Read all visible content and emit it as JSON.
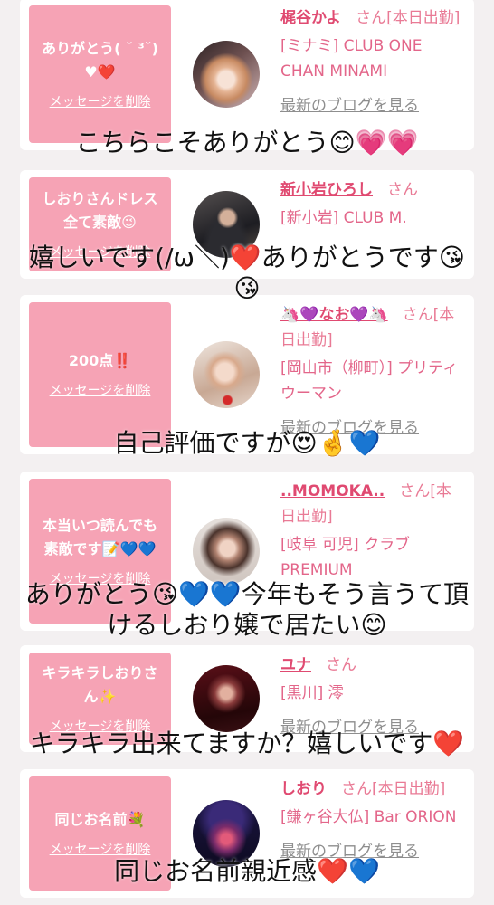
{
  "colors": {
    "background": "#f3f0f1",
    "card": "#ffffff",
    "bubble": "#f6a3b5",
    "name": "#e04a71",
    "suffix": "#e97a95",
    "shop": "#e3668a",
    "blog_link": "#8e8e8e",
    "caption": "#111111"
  },
  "cards": [
    {
      "message": "ありがとう( ˘ ³˘)♥❤️",
      "delete_label": "メッセージを削除",
      "name": "梶谷かよ",
      "suffix": "さん[本日出勤]",
      "shop": "[ミナミ] CLUB ONE CHAN MINAMI",
      "blog_link": "最新のブログを見る"
    },
    {
      "message": "しおりさんドレス全て素敵😉",
      "delete_label": "メッセージを削除",
      "name": "新小岩ひろし",
      "suffix": "さん",
      "shop": "[新小岩] CLUB M."
    },
    {
      "message": "200点‼️",
      "delete_label": "メッセージを削除",
      "name": "🦄💜なお💜🦄",
      "suffix": "さん[本日出勤]",
      "shop": "[岡山市（柳町）] プリティウーマン",
      "blog_link": "最新のブログを見る"
    },
    {
      "message": "本当いつ読んでも素敵です📝💙💙",
      "delete_label": "メッセージを削除",
      "name": "..MOMOKA..",
      "suffix": "さん[本日出勤]",
      "shop": "[岐阜 可児] クラブPREMIUM"
    },
    {
      "message": "キラキラしおりさん✨",
      "delete_label": "メッセージを削除",
      "name": "ユナ",
      "suffix": "さん",
      "shop": "[黒川] 澪",
      "blog_link": "最新のブログを見る"
    },
    {
      "message": "同じお名前💐",
      "delete_label": "メッセージを削除",
      "name": "しおり",
      "suffix": "さん[本日出勤]",
      "shop": "[鎌ヶ谷大仏] Bar ORION",
      "blog_link": "最新のブログを見る"
    }
  ],
  "captions": [
    {
      "lines": [
        "こちらこそありがとう😊💗💗"
      ]
    },
    {
      "lines": [
        "嬉しいです(/ω＼)❤️ありがとうです😘",
        "😘"
      ]
    },
    {
      "lines": [
        "自己評価ですが😍🤞💙"
      ]
    },
    {
      "lines": [
        "ありがとう😘💙💙今年もそう言うて頂",
        "けるしおり嬢で居たい😊"
      ]
    },
    {
      "lines": [
        "キラキラ出来てますか？嬉しいです❤️"
      ]
    },
    {
      "lines": [
        "同じお名前親近感❤️💙"
      ]
    }
  ]
}
